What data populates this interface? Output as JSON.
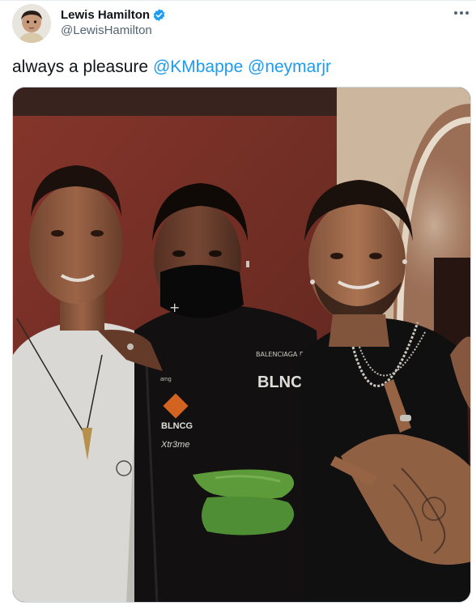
{
  "tweet": {
    "author": {
      "display_name": "Lewis Hamilton",
      "handle": "@LewisHamilton",
      "verified": true,
      "avatar_icon": "baby-photo-avatar"
    },
    "text_parts": [
      {
        "type": "text",
        "value": "always a pleasure "
      },
      {
        "type": "mention",
        "value": "@KMbappe"
      },
      {
        "type": "text",
        "value": " "
      },
      {
        "type": "mention",
        "value": "@neymarjr"
      }
    ],
    "media": {
      "kind": "photo",
      "shirt_texts": {
        "logo_top": "BALENCIAGA PARIS",
        "blnc": "BLNC",
        "blncg": "BLNCG",
        "brand": "Xtr3me",
        "tag": "amg"
      }
    }
  },
  "colors": {
    "link": "#1d9bf0",
    "verified": "#1d9bf0",
    "text_primary": "#0f1419",
    "text_secondary": "#536471"
  },
  "icons": {
    "more": "more-dots-icon",
    "verified": "verified-badge-icon"
  }
}
